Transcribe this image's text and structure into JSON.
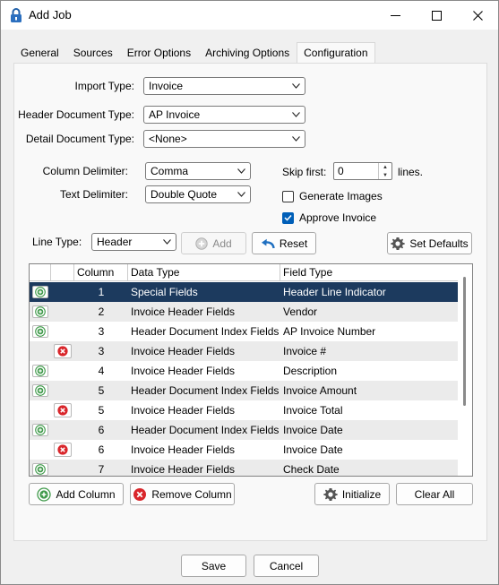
{
  "window": {
    "title": "Add Job"
  },
  "tabs": [
    "General",
    "Sources",
    "Error Options",
    "Archiving Options",
    "Configuration"
  ],
  "active_tab": "Configuration",
  "form": {
    "import_type": {
      "label": "Import Type:",
      "value": "Invoice"
    },
    "header_doc_type": {
      "label": "Header Document Type:",
      "value": "AP Invoice"
    },
    "detail_doc_type": {
      "label": "Detail Document Type:",
      "value": "<None>"
    },
    "column_delimiter": {
      "label": "Column Delimiter:",
      "value": "Comma"
    },
    "text_delimiter": {
      "label": "Text Delimiter:",
      "value": "Double Quote"
    },
    "skip_first": {
      "label": "Skip first:",
      "value": "0",
      "suffix": "lines."
    },
    "generate_images": {
      "label": "Generate Images",
      "checked": false
    },
    "approve_invoice": {
      "label": "Approve Invoice",
      "checked": true
    },
    "line_type": {
      "label": "Line Type:",
      "value": "Header"
    }
  },
  "buttons": {
    "add": "Add",
    "reset": "Reset",
    "set_defaults": "Set Defaults",
    "add_column": "Add Column",
    "remove_column": "Remove Column",
    "initialize": "Initialize",
    "clear_all": "Clear All",
    "save": "Save",
    "cancel": "Cancel"
  },
  "grid": {
    "headers": [
      "",
      "",
      "Column",
      "Data Type",
      "Field Type"
    ],
    "rows": [
      {
        "action": "add",
        "column": "1",
        "data_type": "Special Fields",
        "field_type": "Header Line Indicator",
        "selected": true
      },
      {
        "action": "add",
        "column": "2",
        "data_type": "Invoice Header Fields",
        "field_type": "Vendor"
      },
      {
        "action": "add",
        "column": "3",
        "data_type": "Header Document Index Fields",
        "field_type": "AP Invoice Number"
      },
      {
        "action": "remove",
        "column": "3",
        "data_type": "Invoice Header Fields",
        "field_type": "Invoice #"
      },
      {
        "action": "add",
        "column": "4",
        "data_type": "Invoice Header Fields",
        "field_type": "Description"
      },
      {
        "action": "add",
        "column": "5",
        "data_type": "Header Document Index Fields",
        "field_type": "Invoice Amount"
      },
      {
        "action": "remove",
        "column": "5",
        "data_type": "Invoice Header Fields",
        "field_type": "Invoice Total"
      },
      {
        "action": "add",
        "column": "6",
        "data_type": "Header Document Index Fields",
        "field_type": "Invoice Date"
      },
      {
        "action": "remove",
        "column": "6",
        "data_type": "Invoice Header Fields",
        "field_type": "Invoice Date"
      },
      {
        "action": "add",
        "column": "7",
        "data_type": "Invoice Header Fields",
        "field_type": "Check Date"
      }
    ]
  },
  "colors": {
    "selection": "#1c3a5e",
    "accent": "#005fb8",
    "remove": "#d9262b",
    "add": "#3f9a4a"
  },
  "icons": {
    "app": "lock-icon",
    "add": "add-circle-icon",
    "remove": "remove-circle-icon",
    "reset": "undo-arrow-icon",
    "settings": "gear-icon"
  }
}
